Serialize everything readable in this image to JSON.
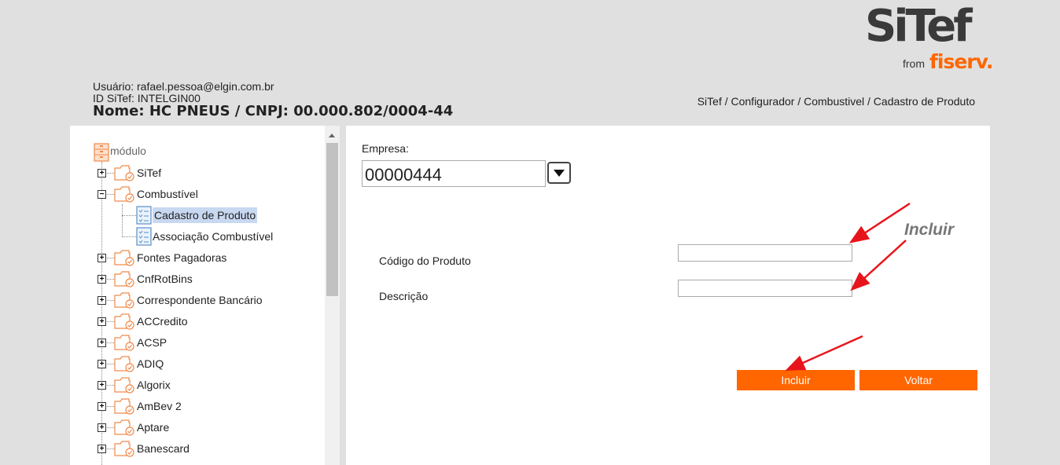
{
  "logo": {
    "main": "SiTef",
    "from": "from",
    "brand": "fiserv."
  },
  "header": {
    "user_line": "Usuário: rafael.pessoa@elgin.com.br",
    "id_line": "ID SiTef: INTELGIN00",
    "nome_line": "Nome: HC PNEUS / CNPJ: 00.000.802/0004-44",
    "breadcrumb": "SiTef / Configurador / Combustivel / Cadastro de Produto"
  },
  "tree": {
    "root": "módulo",
    "items": [
      {
        "label": "SiTef",
        "expander": "+"
      },
      {
        "label": "Combustível",
        "expander": "−"
      },
      {
        "label": "Cadastro de Produto",
        "selected": true
      },
      {
        "label": "Associação Combustível"
      },
      {
        "label": "Fontes Pagadoras",
        "expander": "+"
      },
      {
        "label": "CnfRotBins",
        "expander": "+"
      },
      {
        "label": "Correspondente Bancário",
        "expander": "+"
      },
      {
        "label": "ACCredito",
        "expander": "+"
      },
      {
        "label": "ACSP",
        "expander": "+"
      },
      {
        "label": "ADIQ",
        "expander": "+"
      },
      {
        "label": "Algorix",
        "expander": "+"
      },
      {
        "label": "AmBev 2",
        "expander": "+"
      },
      {
        "label": "Aptare",
        "expander": "+"
      },
      {
        "label": "Banescard",
        "expander": "+"
      }
    ]
  },
  "form": {
    "empresa_label": "Empresa:",
    "empresa_value": "00000444",
    "annotation": "Incluir",
    "codigo_label": "Código do Produto",
    "codigo_value": "",
    "descricao_label": "Descrição",
    "descricao_value": "",
    "incluir_label": "Incluir",
    "voltar_label": "Voltar"
  },
  "colors": {
    "accent": "#ff6600",
    "arrow": "#e8141b",
    "selection": "#c8d8f0"
  }
}
